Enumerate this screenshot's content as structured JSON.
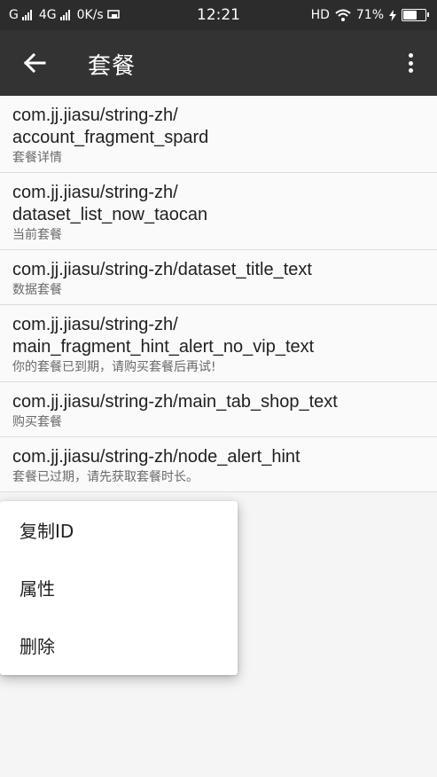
{
  "status_bar": {
    "carrier1": "G",
    "carrier2": "4G",
    "net_speed": "0K/s",
    "time": "12:21",
    "hd": "HD",
    "battery": "71%",
    "battery_level": 0.71
  },
  "app_bar": {
    "title": "套餐",
    "back_icon": "arrow-left-icon",
    "more_icon": "more-vert-icon"
  },
  "items": [
    {
      "key": "com.jj.jiasu/string-zh/\naccount_fragment_spard",
      "value": "套餐详情"
    },
    {
      "key": "com.jj.jiasu/string-zh/\ndataset_list_now_taocan",
      "value": "当前套餐"
    },
    {
      "key": "com.jj.jiasu/string-zh/dataset_title_text",
      "value": "数据套餐"
    },
    {
      "key": "com.jj.jiasu/string-zh/\nmain_fragment_hint_alert_no_vip_text",
      "value": "你的套餐已到期，请购买套餐后再试!"
    },
    {
      "key": "com.jj.jiasu/string-zh/main_tab_shop_text",
      "value": "购买套餐"
    },
    {
      "key": "com.jj.jiasu/string-zh/node_alert_hint",
      "value": "套餐已过期，请先获取套餐时长。"
    }
  ],
  "context_menu": {
    "copy_id": "复制ID",
    "properties": "属性",
    "delete": "删除"
  }
}
